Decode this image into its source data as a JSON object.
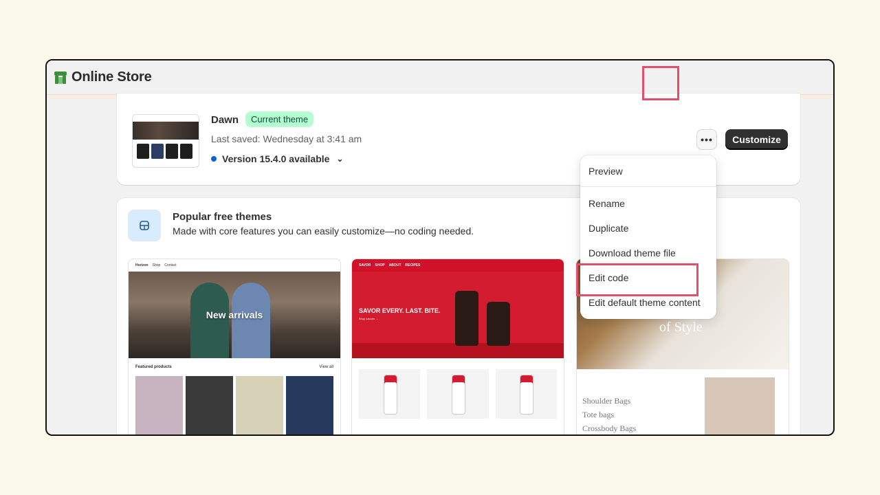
{
  "header": {
    "title": "Online Store"
  },
  "current_theme": {
    "name": "Dawn",
    "badge": "Current theme",
    "last_saved": "Last saved: Wednesday at 3:41 am",
    "version": "Version 15.4.0 available",
    "more_label": "•••",
    "customize_label": "Customize"
  },
  "popular": {
    "title": "Popular free themes",
    "subtitle": "Made with core features you can easily customize—no coding needed.",
    "themes": [
      {
        "brand": "Horizon",
        "nav": [
          "Shop",
          "Contact"
        ],
        "hero_text": "New arrivals",
        "section": "Featured products",
        "view_all": "View all"
      },
      {
        "brand": "SAVOR",
        "nav": [
          "SHOP",
          "ABOUT",
          "RECIPES"
        ],
        "hero_text": "SAVOR EVERY. LAST. BITE.",
        "hero_sub": "Shop sauces →"
      },
      {
        "hero_text": "of Style",
        "list": [
          "Shoulder Bags",
          "Tote bags",
          "Crossbody Bags"
        ]
      }
    ]
  },
  "menu": {
    "items": [
      "Preview",
      "Rename",
      "Duplicate",
      "Download theme file",
      "Edit code",
      "Edit default theme content"
    ]
  },
  "colors": {
    "accent_highlight": "#e0506a",
    "badge_bg": "#b4fed2",
    "primary_button": "#303030",
    "version_dot": "#0b62d6"
  }
}
